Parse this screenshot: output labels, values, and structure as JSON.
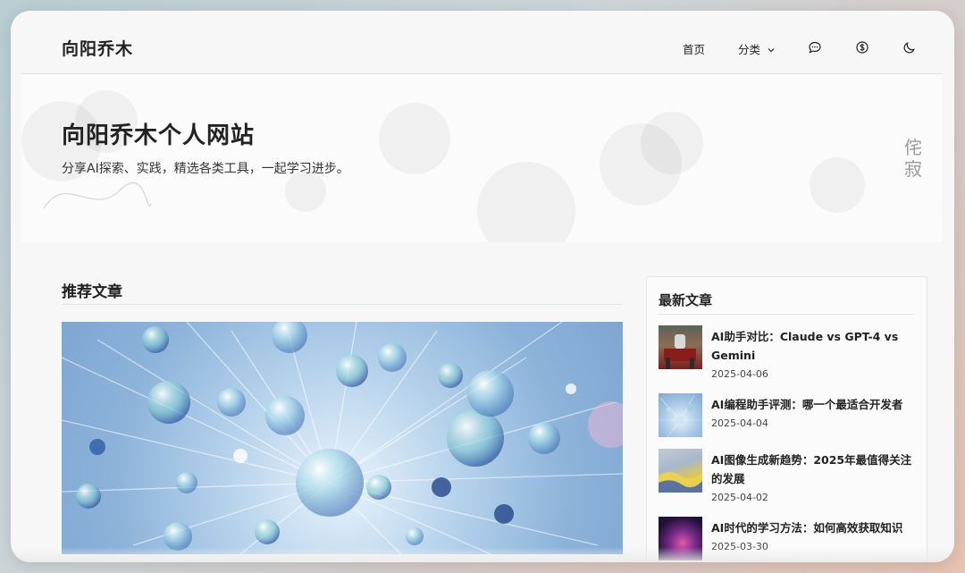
{
  "site": {
    "brand": "向阳乔木"
  },
  "nav": {
    "home": "首页",
    "categories": "分类",
    "icons": [
      "chat-icon",
      "dollar-icon",
      "moon-icon"
    ]
  },
  "hero": {
    "title": "向阳乔木个人网站",
    "subtitle": "分享AI探索、实践，精选各类工具，一起学习进步。",
    "side_text": "侘寂"
  },
  "main": {
    "section_title": "推荐文章"
  },
  "sidebar": {
    "title": "最新文章",
    "posts": [
      {
        "title": "AI助手对比：Claude vs GPT-4 vs Gemini",
        "date": "2025-04-06"
      },
      {
        "title": "AI编程助手评测：哪一个最适合开发者",
        "date": "2025-04-04"
      },
      {
        "title": "AI图像生成新趋势：2025年最值得关注的发展",
        "date": "2025-04-02"
      },
      {
        "title": "AI时代的学习方法：如何高效获取知识",
        "date": "2025-03-30"
      }
    ]
  },
  "colors": {
    "text": "#222222",
    "muted": "#9a9a9a",
    "card_bg": "#fbfbfb"
  }
}
